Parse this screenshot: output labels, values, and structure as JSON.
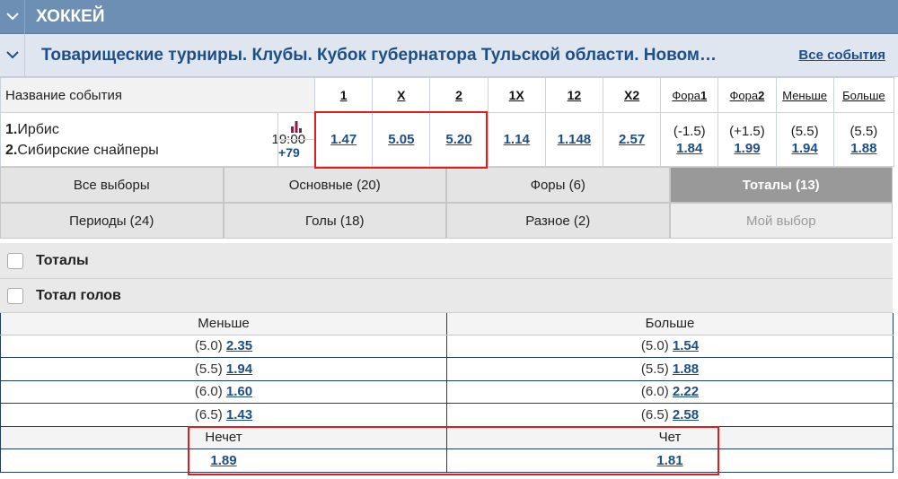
{
  "sport": {
    "title": "ХОККЕЙ"
  },
  "tournament": {
    "title": "Товарищеские турниры. Клубы. Кубок губернатора Тульской области. Новом…",
    "all_events": "Все события"
  },
  "odds_header": {
    "name": "Название события",
    "cols": [
      "1",
      "X",
      "2",
      "1X",
      "12",
      "X2"
    ],
    "fora1_prefix": "Фора",
    "fora1_num": "1",
    "fora2_prefix": "Фора",
    "fora2_num": "2",
    "less": "Меньше",
    "more": "Больше"
  },
  "event": {
    "team1_num": "1.",
    "team1": "Ирбис",
    "team2_num": "2.",
    "team2": "Сибирские снайперы",
    "time": "19:00",
    "more": "+79",
    "odds": [
      "1.47",
      "5.05",
      "5.20",
      "1.14",
      "1.148",
      "2.57"
    ],
    "fora1_hc": "(-1.5)",
    "fora1_odd": "1.84",
    "fora2_hc": "(+1.5)",
    "fora2_odd": "1.99",
    "less_hc": "(5.5)",
    "less_odd": "1.94",
    "more_hc": "(5.5)",
    "more_odd": "1.88"
  },
  "tabs": {
    "row1": [
      "Все выборы",
      "Основные (20)",
      "Форы (6)",
      "Тоталы (13)"
    ],
    "row2": [
      "Периоды (24)",
      "Голы (18)",
      "Разное (2)",
      "Мой выбор"
    ]
  },
  "groups": {
    "totals": "Тоталы",
    "total_goals": "Тотал голов"
  },
  "totals_table": {
    "less_header": "Меньше",
    "more_header": "Больше",
    "rows": [
      {
        "lv": "(5.0)",
        "lo": "2.35",
        "rv": "(5.0)",
        "ro": "1.54"
      },
      {
        "lv": "(5.5)",
        "lo": "1.94",
        "rv": "(5.5)",
        "ro": "1.88"
      },
      {
        "lv": "(6.0)",
        "lo": "1.60",
        "rv": "(6.0)",
        "ro": "2.22"
      },
      {
        "lv": "(6.5)",
        "lo": "1.43",
        "rv": "(6.5)",
        "ro": "2.58"
      }
    ],
    "odd_label": "Нечет",
    "even_label": "Чет",
    "odd_value": "1.89",
    "even_value": "1.81"
  },
  "colors": {
    "header_bg": "#6c8fb3",
    "link": "#1d4f86",
    "highlight": "#e21b1b",
    "active_tab": "#999999"
  }
}
